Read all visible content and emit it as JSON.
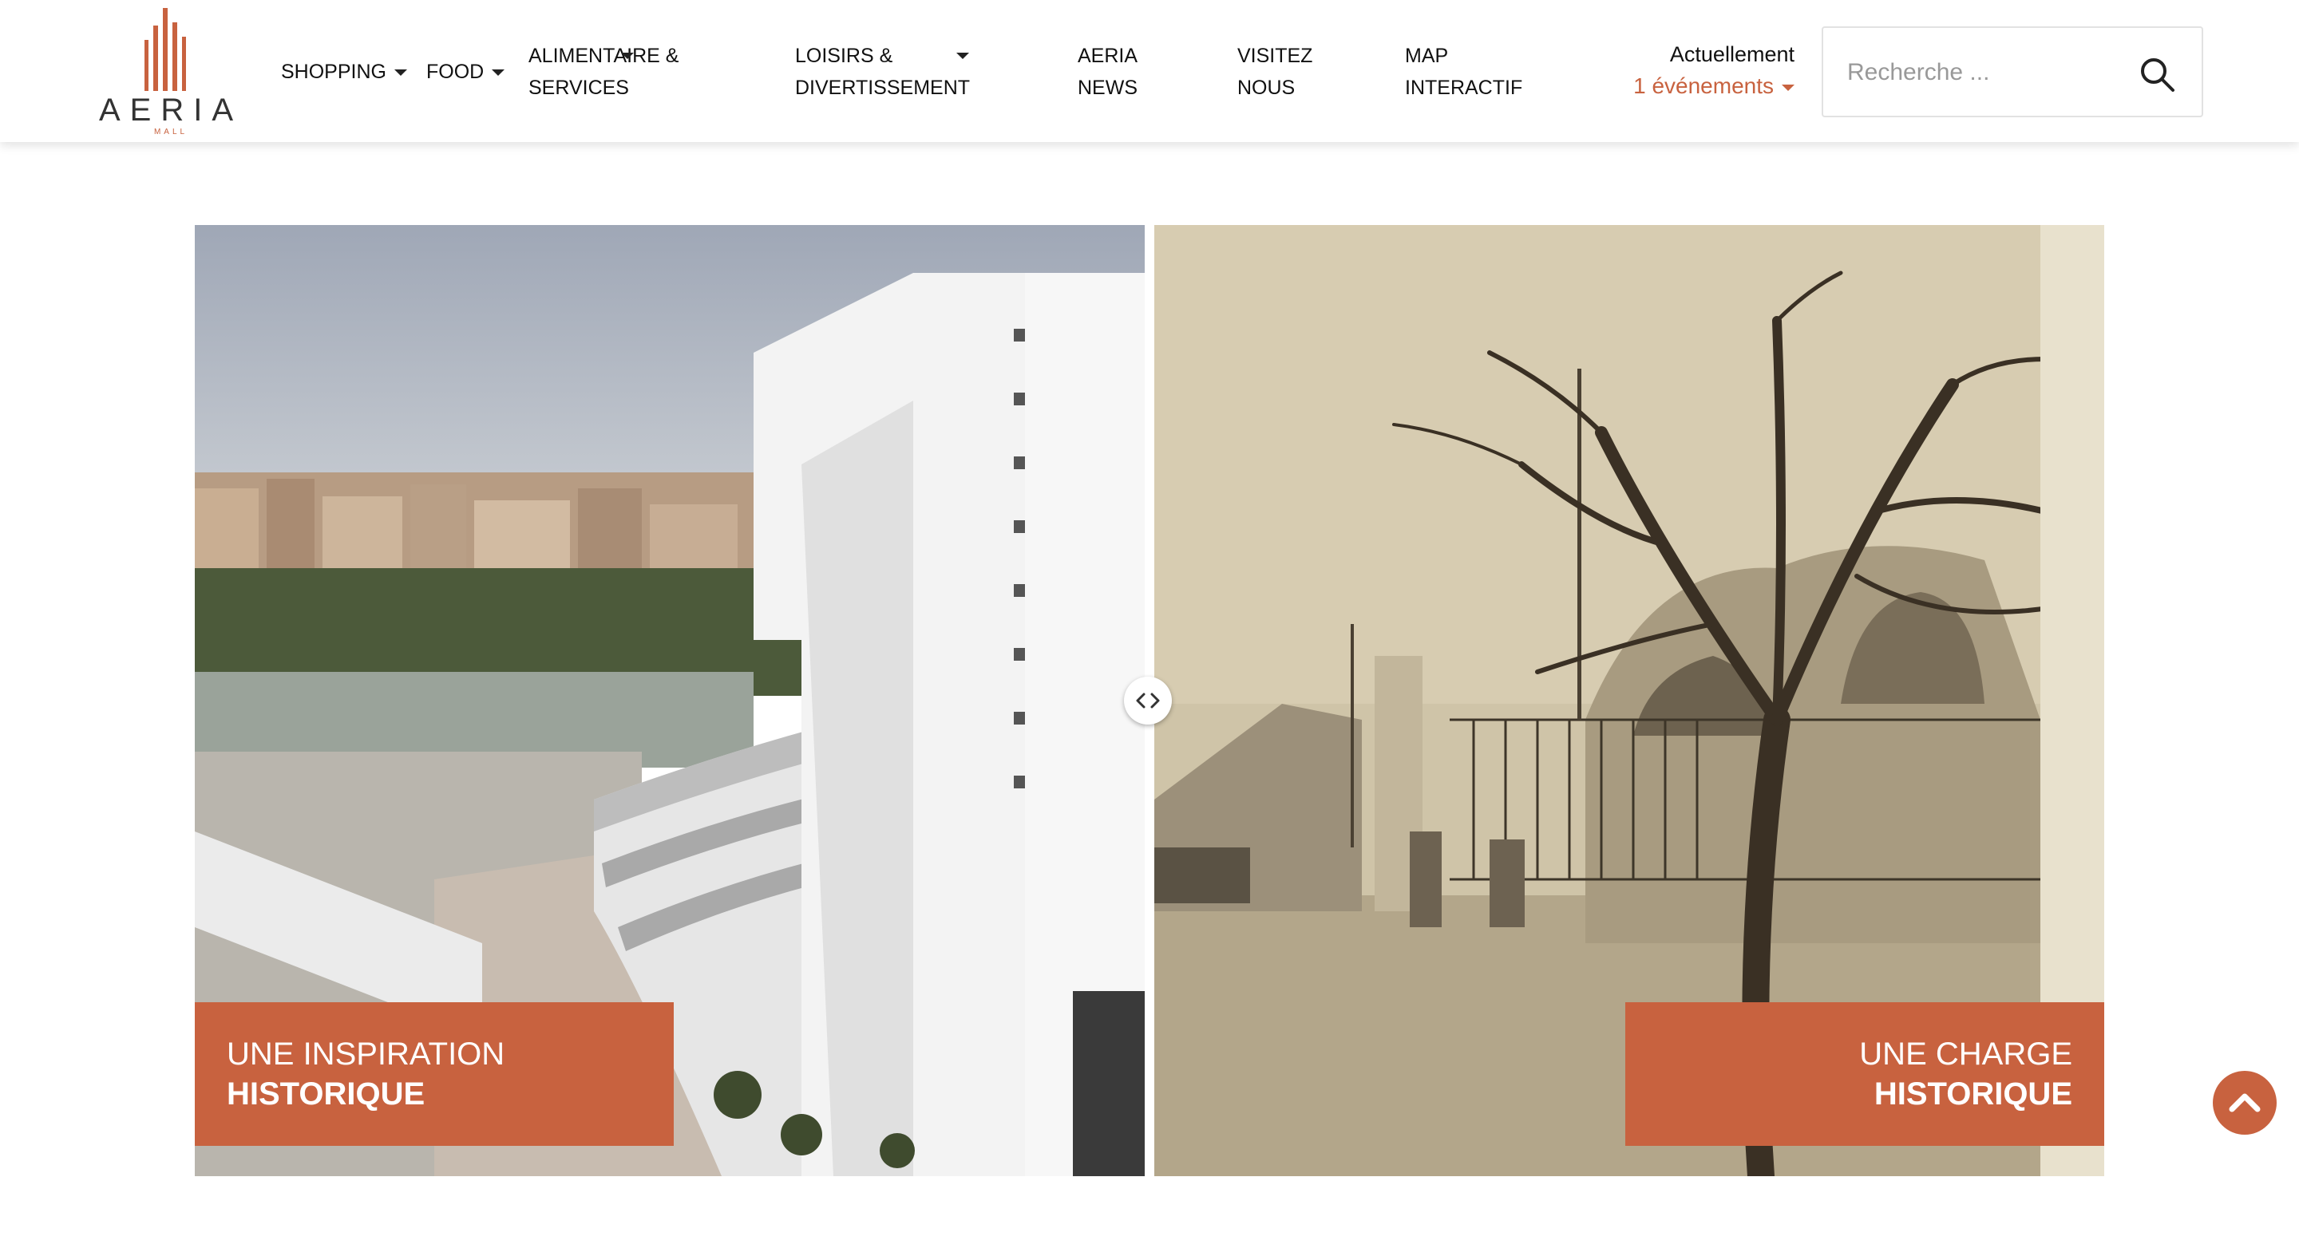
{
  "logo": {
    "word": "AERIA",
    "sub": "MALL"
  },
  "nav": {
    "shopping": "SHOPPING",
    "food": "FOOD",
    "alimentaire_1": "ALIMENTAIRE &",
    "alimentaire_2": "SERVICES",
    "loisirs_1": "LOISIRS &",
    "loisirs_2": "DIVERTISSEMENT",
    "news_1": "AERIA",
    "news_2": "NEWS",
    "visitez_1": "VISITEZ",
    "visitez_2": "NOUS",
    "map_1": "MAP",
    "map_2": "INTERACTIF"
  },
  "events": {
    "label": "Actuellement",
    "count": "1 événements"
  },
  "search": {
    "placeholder": "Recherche ..."
  },
  "compare": {
    "left_line1": "UNE INSPIRATION",
    "left_line2": "HISTORIQUE",
    "right_line1": "UNE CHARGE",
    "right_line2": "HISTORIQUE"
  },
  "colors": {
    "accent": "#c8623f",
    "sepia": "#bdae8e"
  },
  "icons": {
    "search": "search-icon",
    "handle": "compare-handle-icon",
    "scroll": "chevron-up-icon"
  }
}
